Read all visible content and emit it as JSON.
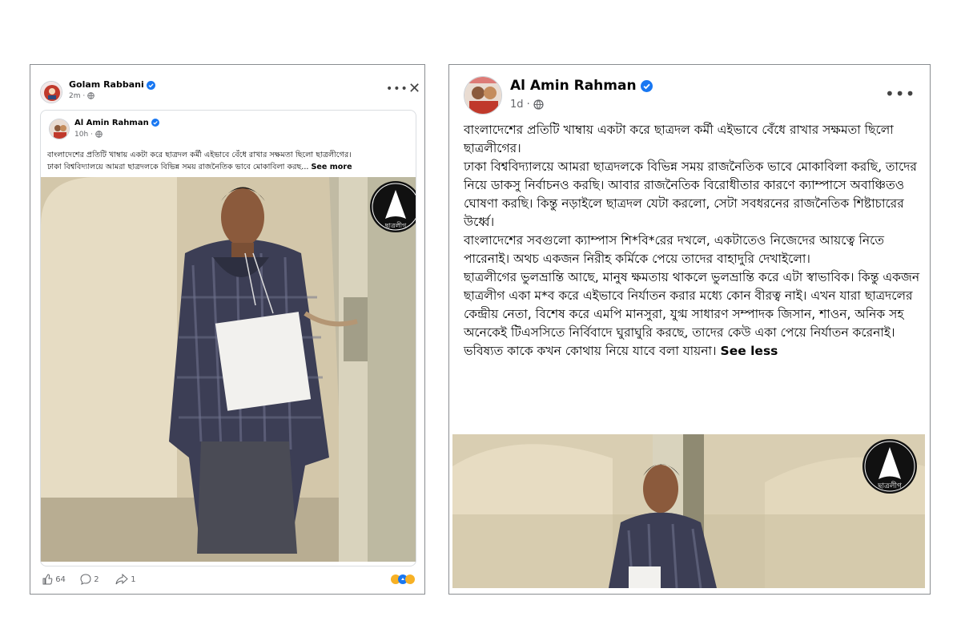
{
  "left_post": {
    "author": "Golam Rabbani",
    "time": "2m",
    "more_icon": "more-horizontal-icon",
    "close_icon": "close-icon",
    "shared": {
      "author": "Al Amin Rahman",
      "time": "10h",
      "text_line1": "বাংলাদেশের প্রতিটি খাম্বায় একটা করে ছাত্রদল কর্মী এইভাবে বেঁধে রাখার সক্ষমতা ছিলো ছাত্রলীগের।",
      "text_line2": "ঢাকা বিশ্ববিদ্যালয়ে আমরা ছাত্রদলকে বিভিন্ন সময় রাজনৈতিক ভাবে মোকাবিলা করছ...",
      "see_more": "See more"
    },
    "reactions": {
      "likes": "64",
      "comments": "2",
      "shares": "1"
    }
  },
  "right_post": {
    "author": "Al Amin Rahman",
    "time": "1d",
    "paragraphs": [
      "বাংলাদেশের প্রতিটি খাম্বায় একটা করে ছাত্রদল কর্মী এইভাবে বেঁধে রাখার সক্ষমতা ছিলো ছাত্রলীগের।",
      "ঢাকা বিশ্ববিদ্যালয়ে আমরা ছাত্রদলকে বিভিন্ন সময় রাজনৈতিক ভাবে মোকাবিলা করছি, তাদের নিয়ে ডাকসু নির্বাচনও করছি। আবার রাজনৈতিক বিরোধীতার কারণে ক্যাম্পাসে অবাঞ্চিতও ঘোষণা করছি। কিন্তু নড়াইলে ছাত্রদল যেটা করলো, সেটা সবধরনের রাজনৈতিক শিষ্টাচারের উর্ধ্বে।",
      "বাংলাদেশের সবগুলো ক্যাম্পাস শি*বি*রের দখলে, একটাতেও নিজেদের আয়ত্বে নিতে পারেনাই। অথচ একজন নিরীহ কর্মিকে পেয়ে তাদের বাহাদুরি দেখাইলো।",
      "ছাত্রলীগের ভুলভ্রান্তি আছে, মানুষ ক্ষমতায় থাকলে ভুলভ্রান্তি করে এটা স্বাভাবিক। কিন্তু একজন ছাত্রলীগ একা ম*ব করে এইভাবে নির্যাতন করার মধ্যে কোন বীরত্ব নাই। এখন যারা ছাত্রদলের কেন্দ্রীয় নেতা, বিশেষ করে এমপি মানসুরা, যুগ্ম সাধারণ সম্পাদক জিসান, শাওন, অনিক সহ অনেকেই টিএসসিতে নির্বিবাদে ঘুরাঘুরি করছে, তাদের কেউ একা পেয়ে নির্যাতন করেনাই।"
    ],
    "last_line": "ভবিষ্যত কাকে কখন কোথায় নিয়ে যাবে বলা যায়না।",
    "see_less": "See less"
  },
  "logo_text": "ছাত্রলীগ",
  "colors": {
    "verified": "#1877f2",
    "meta_text": "#65676b",
    "border": "#dadde1",
    "wall": "#d8cdb0",
    "shirt": "#3c3e55"
  }
}
